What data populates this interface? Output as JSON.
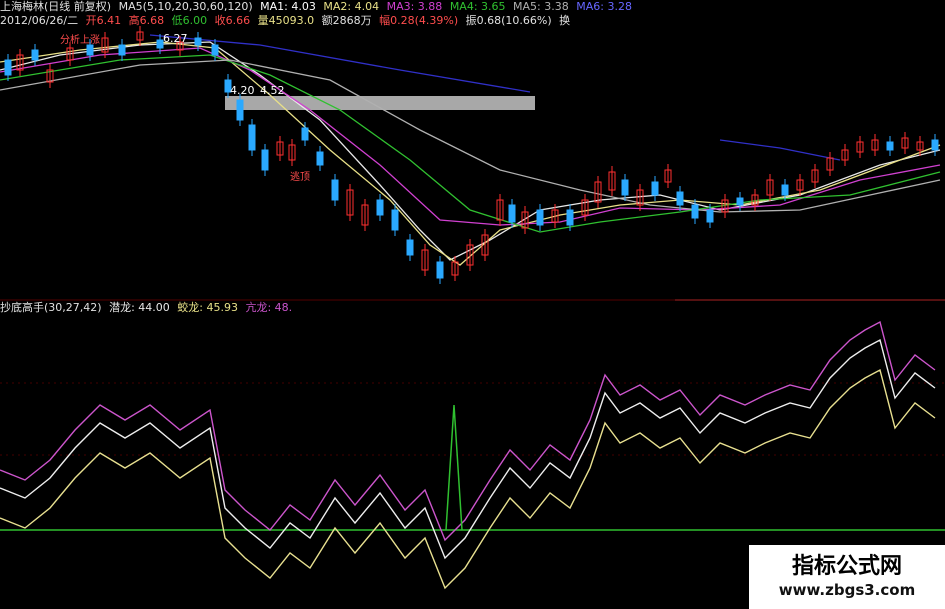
{
  "header": {
    "stock": "上海梅林(日线 前复权)",
    "ma_title": "MA5(5,10,20,30,60,120)",
    "ma1": "MA1: 4.03",
    "ma2": "MA2: 4.04",
    "ma3": "MA3: 3.88",
    "ma4": "MA4: 3.65",
    "ma5": "MA5: 3.38",
    "ma6": "MA6: 3.28"
  },
  "info": {
    "date": "2012/06/26/二",
    "open": "开6.41",
    "high": "高6.68",
    "low": "低6.00",
    "close": "收6.66",
    "volume": "量45093.0",
    "amount": "额2868万",
    "change": "幅0.28(4.39%)",
    "amplitude": "振0.68(10.66%)",
    "turnover": "换"
  },
  "annotations": {
    "high_price": "6.27",
    "low_box_price": "4.52",
    "low_box_prefix": "4.20",
    "signal_split": "分析上涨",
    "signal_top": "逃顶"
  },
  "indicator": {
    "name": "抄底高手(30,27,42)",
    "qianlong": "潜龙: 44.00",
    "jiaolong": "蛟龙: 45.93",
    "kanglong": "亢龙: 48."
  },
  "watermark": {
    "title": "指标公式网",
    "url": "www.zbgs3.com"
  },
  "colors": {
    "up": "#ff3030",
    "down": "#2aa9ff",
    "ma_white": "#e8e8e8",
    "ma_yellow": "#e8e088",
    "ma_magenta": "#d040d0",
    "ma_green": "#30c030",
    "ma_gray": "#b0b0b0",
    "ma_blue": "#3030c8",
    "line_magenta": "#cc55cc",
    "line_white": "#eeeeee",
    "line_yellow": "#e8e090",
    "spike_green": "#30c030"
  }
}
